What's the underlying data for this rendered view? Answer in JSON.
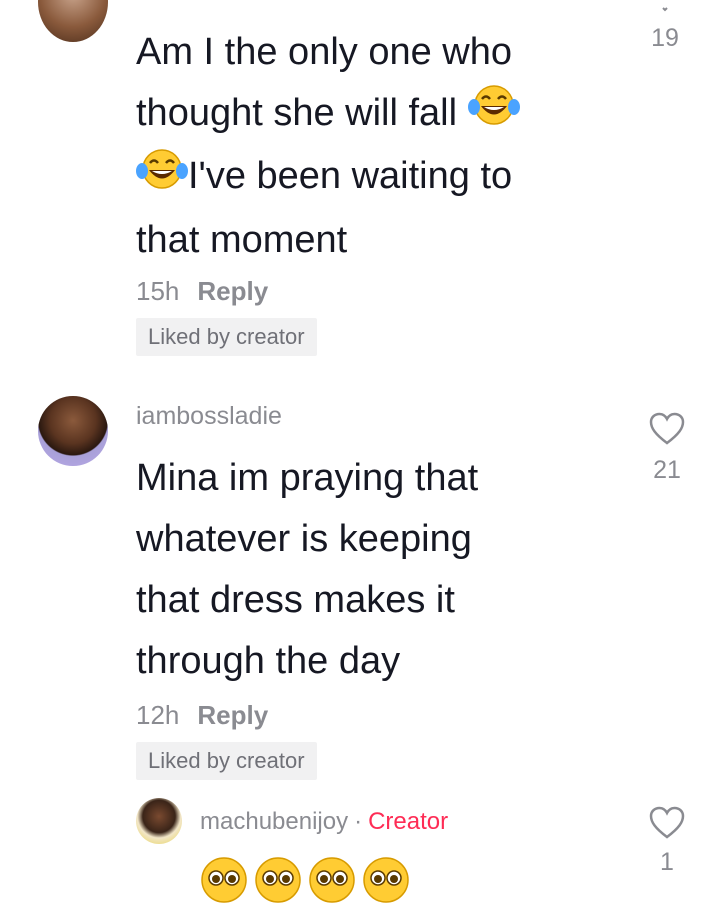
{
  "comments": [
    {
      "text_lines": [
        "Am I the only one who",
        "thought she will fall",
        "I've been waiting to",
        "that moment"
      ],
      "time": "15h",
      "reply_label": "Reply",
      "liked_label": "Liked by creator",
      "like_count": "19"
    },
    {
      "username": "iambossladie",
      "text_lines": [
        "Mina im praying that",
        "whatever is keeping",
        "that dress makes it",
        "through the day"
      ],
      "time": "12h",
      "reply_label": "Reply",
      "liked_label": "Liked by creator",
      "like_count": "21"
    },
    {
      "username": "machubenijoy",
      "separator": "·",
      "creator_label": "Creator",
      "like_count": "1",
      "emoji": [
        "pleading-face",
        "pleading-face",
        "pleading-face",
        "pleading-face"
      ]
    }
  ],
  "icons": {
    "like": "heart-outline-icon",
    "laugh": "tears-of-joy-emoji"
  },
  "colors": {
    "creator": "#fe2c55",
    "muted": "#8a8b91",
    "text": "#161823",
    "liked_bg": "#f1f1f2"
  }
}
